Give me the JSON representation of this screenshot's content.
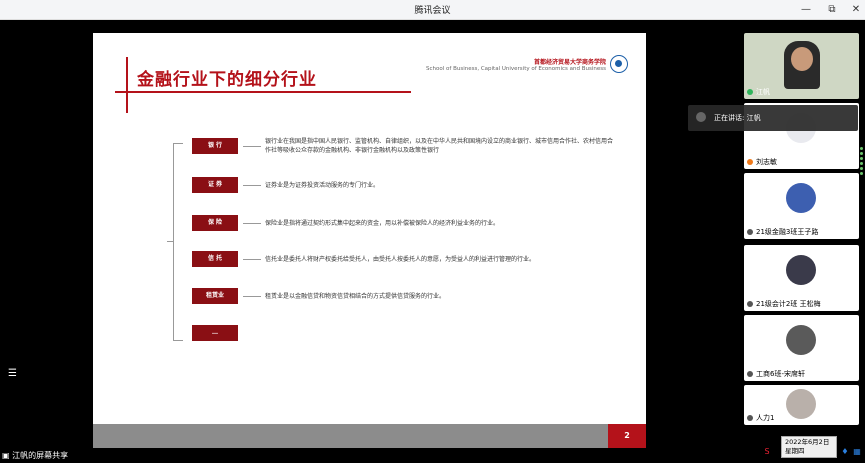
{
  "window": {
    "title": "腾讯会议",
    "controls": [
      "—",
      "⧉",
      "✕"
    ]
  },
  "slide": {
    "title": "金融行业下的细分行业",
    "school_cn": "首都经济贸易大学商务学院",
    "school_en": "School of Business, Capital University of Economics and Business",
    "page_number": "2",
    "items": [
      {
        "label": "银 行",
        "text": "银行业在我国是指中国人民银行、监管机构、自律组织，以及在中华人民共和国境内设立的商业银行、城市信用合作社、农村信用合作社等吸收公众存款的金融机构、非银行金融机构以及政策性银行"
      },
      {
        "label": "证 券",
        "text": "证券业是为证券投资活动服务的专门行业。"
      },
      {
        "label": "保 险",
        "text": "保险业是指将通过契约形式集中起来的资金，用以补偿被保险人的经济利益业务的行业。"
      },
      {
        "label": "信 托",
        "text": "信托业是委托人将财产权委托给受托人，由受托人按委托人的意愿，为受益人的利益进行管理的行业。"
      },
      {
        "label": "租赁业",
        "text": "租赁业是以金融信贷和物资信贷相结合的方式提供信贷服务的行业。"
      },
      {
        "label": "…",
        "text": ""
      }
    ]
  },
  "speaking_banner": "正在讲话: 江帆",
  "participants": [
    {
      "name": "江帆",
      "bg": "#cfd7c4"
    },
    {
      "name": "刘志敏",
      "bg": "#ffffff"
    },
    {
      "name": "21级金融3班王子路",
      "bg": "#ffffff"
    },
    {
      "name": "21级会计2班 王松梅",
      "bg": "#ffffff"
    },
    {
      "name": "工商6班-宋席轩",
      "bg": "#ffffff"
    },
    {
      "name": "人力1",
      "bg": "#ffffff"
    }
  ],
  "share_label": "江帆的屏幕共享",
  "datetime": {
    "date": "2022年6月2日",
    "weekday": "星期四"
  },
  "colors": {
    "accent": "#b4121a",
    "label_bg": "#8a0f14"
  }
}
